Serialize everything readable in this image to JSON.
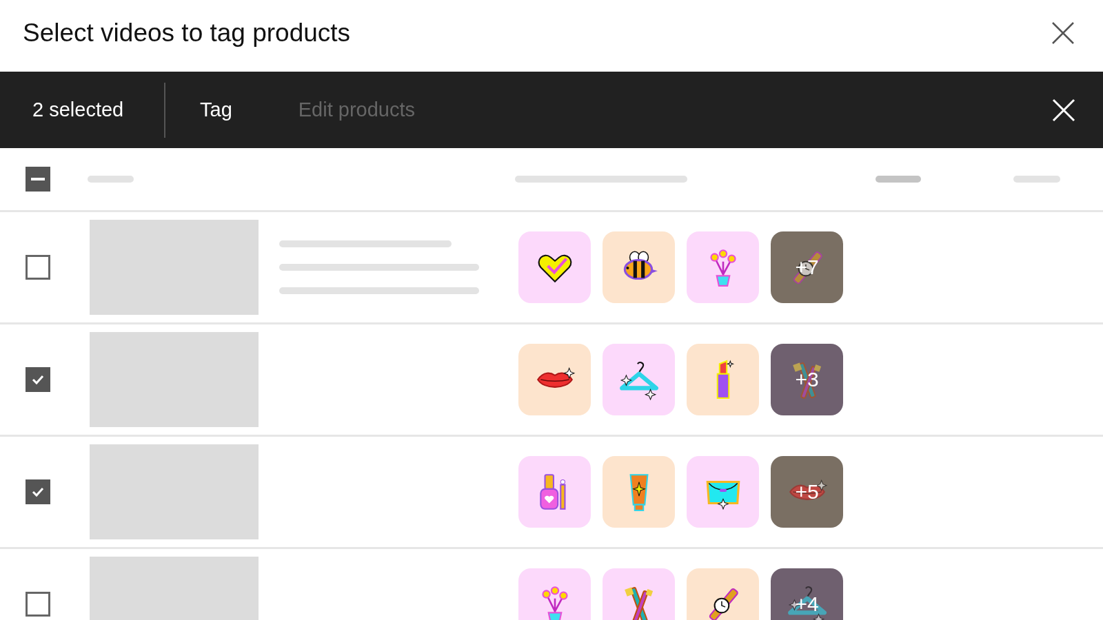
{
  "dialog": {
    "title": "Select videos to tag products"
  },
  "action_bar": {
    "selected_count": "2 selected",
    "actions": [
      {
        "label": "Tag",
        "disabled": false
      },
      {
        "label": "Edit products",
        "disabled": true
      }
    ]
  },
  "header_checkbox": {
    "indeterminate": true
  },
  "rows": [
    {
      "selected": false,
      "products": [
        {
          "kind": "heart"
        },
        {
          "kind": "bee"
        },
        {
          "kind": "flower"
        }
      ],
      "more": {
        "kind": "watch",
        "count": "+7"
      }
    },
    {
      "selected": true,
      "products": [
        {
          "kind": "lips"
        },
        {
          "kind": "hanger"
        },
        {
          "kind": "lipstick"
        }
      ],
      "more": {
        "kind": "brushes",
        "count": "+3"
      }
    },
    {
      "selected": true,
      "products": [
        {
          "kind": "polish"
        },
        {
          "kind": "tube"
        },
        {
          "kind": "bag"
        }
      ],
      "more": {
        "kind": "lips",
        "count": "+5"
      }
    },
    {
      "selected": false,
      "products": [
        {
          "kind": "flower"
        },
        {
          "kind": "brushes"
        },
        {
          "kind": "watch"
        }
      ],
      "more": {
        "kind": "hanger",
        "count": "+4"
      }
    }
  ]
}
